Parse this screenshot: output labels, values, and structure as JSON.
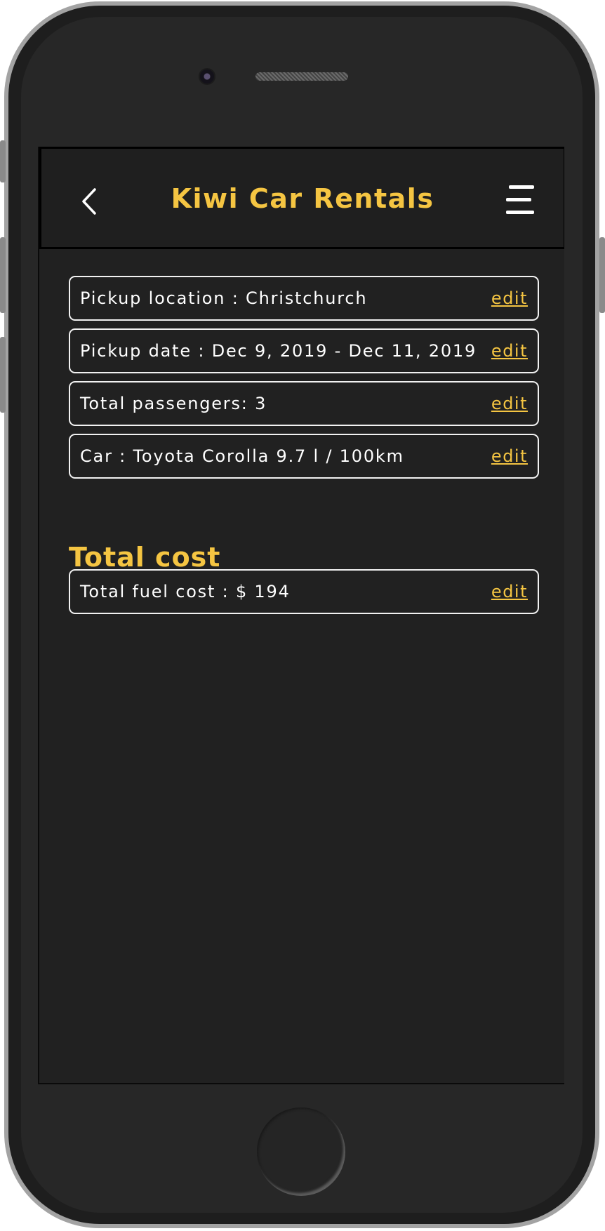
{
  "app": {
    "title": "Kiwi Car Rentals"
  },
  "header": {
    "back_icon": "chevron-left-icon",
    "menu_icon": "hamburger-menu-icon"
  },
  "booking": {
    "rows": [
      {
        "text": "Pickup location : Christchurch",
        "action": "edit"
      },
      {
        "text": "Pickup date : Dec 9, 2019 - Dec 11, 2019",
        "action": "edit"
      },
      {
        "text": "Total passengers: 3",
        "action": "edit"
      },
      {
        "text": "Car : Toyota Corolla 9.7 l / 100km",
        "action": "edit"
      }
    ]
  },
  "cost": {
    "section_title": "Total cost",
    "rows": [
      {
        "text": "Total fuel cost : $ 194",
        "action": "edit"
      }
    ]
  },
  "colors": {
    "accent": "#f5c542",
    "background": "#212121",
    "text": "#ffffff"
  }
}
